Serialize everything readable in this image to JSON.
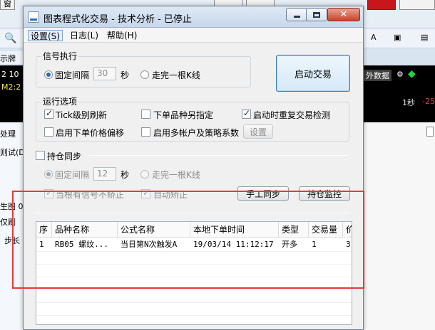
{
  "background": {
    "top_buttons": [
      {
        "label": "窗",
        "color": "#f2f2f2"
      },
      {
        "label": "",
        "color": "#f2f2f2"
      },
      {
        "label": "",
        "color": "#c8161d"
      }
    ],
    "left_labels": [
      "示牌",
      "2 10",
      "M2:2",
      "处理",
      "则试(D",
      "生图 0",
      "仅刷",
      "步长"
    ],
    "ticker_text": "外数据",
    "right_labels": [
      "1秒",
      "-25"
    ]
  },
  "dialog": {
    "title": "图表程式化交易 - 技术分析 - 已停止",
    "menu": [
      "设置(S)",
      "日志(L)",
      "帮助(H)"
    ],
    "signal_group": {
      "title": "信号执行",
      "fixed_interval_label": "固定间隔",
      "interval_value": "30",
      "unit": "秒",
      "complete_bar_label": "走完一根K线",
      "start_button": "启动交易"
    },
    "run_options": {
      "title": "运行选项",
      "items": [
        {
          "label": "Tick级别刷新",
          "checked": true
        },
        {
          "label": "下单品种另指定",
          "checked": false
        },
        {
          "label": "启动时重复交易检测",
          "checked": true
        },
        {
          "label": "启用下单价格偏移",
          "checked": false
        },
        {
          "label": "启用多帐户及策略系数",
          "checked": false
        }
      ],
      "settings_button": "设置"
    },
    "position_sync": {
      "label": "持仓同步",
      "fixed_interval_label": "固定间隔",
      "interval_value": "12",
      "unit": "秒",
      "complete_bar_label": "走完一根K线",
      "correct_on_signal_label": "当根有信号不矫正",
      "auto_correct_label": "自动矫正",
      "manual_sync_button": "手工同步",
      "position_monitor_button": "持仓监控"
    },
    "table": {
      "columns": [
        "序",
        "品种名称",
        "公式名称",
        "本地下单时间",
        "类型",
        "交易量",
        "价"
      ],
      "rows": [
        [
          "1",
          "RB05 螺纹...",
          "当日第N次触发A",
          "19/03/14 11:12:17",
          "开多",
          "1",
          "3"
        ]
      ]
    },
    "highlight_color": "#e5393b"
  }
}
